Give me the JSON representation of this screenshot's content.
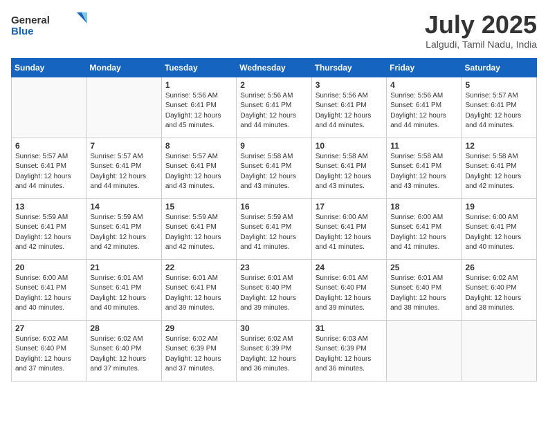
{
  "header": {
    "logo_general": "General",
    "logo_blue": "Blue",
    "title": "July 2025",
    "location": "Lalgudi, Tamil Nadu, India"
  },
  "days_of_week": [
    "Sunday",
    "Monday",
    "Tuesday",
    "Wednesday",
    "Thursday",
    "Friday",
    "Saturday"
  ],
  "weeks": [
    [
      {
        "day": "",
        "info": ""
      },
      {
        "day": "",
        "info": ""
      },
      {
        "day": "1",
        "info": "Sunrise: 5:56 AM\nSunset: 6:41 PM\nDaylight: 12 hours and 45 minutes."
      },
      {
        "day": "2",
        "info": "Sunrise: 5:56 AM\nSunset: 6:41 PM\nDaylight: 12 hours and 44 minutes."
      },
      {
        "day": "3",
        "info": "Sunrise: 5:56 AM\nSunset: 6:41 PM\nDaylight: 12 hours and 44 minutes."
      },
      {
        "day": "4",
        "info": "Sunrise: 5:56 AM\nSunset: 6:41 PM\nDaylight: 12 hours and 44 minutes."
      },
      {
        "day": "5",
        "info": "Sunrise: 5:57 AM\nSunset: 6:41 PM\nDaylight: 12 hours and 44 minutes."
      }
    ],
    [
      {
        "day": "6",
        "info": "Sunrise: 5:57 AM\nSunset: 6:41 PM\nDaylight: 12 hours and 44 minutes."
      },
      {
        "day": "7",
        "info": "Sunrise: 5:57 AM\nSunset: 6:41 PM\nDaylight: 12 hours and 44 minutes."
      },
      {
        "day": "8",
        "info": "Sunrise: 5:57 AM\nSunset: 6:41 PM\nDaylight: 12 hours and 43 minutes."
      },
      {
        "day": "9",
        "info": "Sunrise: 5:58 AM\nSunset: 6:41 PM\nDaylight: 12 hours and 43 minutes."
      },
      {
        "day": "10",
        "info": "Sunrise: 5:58 AM\nSunset: 6:41 PM\nDaylight: 12 hours and 43 minutes."
      },
      {
        "day": "11",
        "info": "Sunrise: 5:58 AM\nSunset: 6:41 PM\nDaylight: 12 hours and 43 minutes."
      },
      {
        "day": "12",
        "info": "Sunrise: 5:58 AM\nSunset: 6:41 PM\nDaylight: 12 hours and 42 minutes."
      }
    ],
    [
      {
        "day": "13",
        "info": "Sunrise: 5:59 AM\nSunset: 6:41 PM\nDaylight: 12 hours and 42 minutes."
      },
      {
        "day": "14",
        "info": "Sunrise: 5:59 AM\nSunset: 6:41 PM\nDaylight: 12 hours and 42 minutes."
      },
      {
        "day": "15",
        "info": "Sunrise: 5:59 AM\nSunset: 6:41 PM\nDaylight: 12 hours and 42 minutes."
      },
      {
        "day": "16",
        "info": "Sunrise: 5:59 AM\nSunset: 6:41 PM\nDaylight: 12 hours and 41 minutes."
      },
      {
        "day": "17",
        "info": "Sunrise: 6:00 AM\nSunset: 6:41 PM\nDaylight: 12 hours and 41 minutes."
      },
      {
        "day": "18",
        "info": "Sunrise: 6:00 AM\nSunset: 6:41 PM\nDaylight: 12 hours and 41 minutes."
      },
      {
        "day": "19",
        "info": "Sunrise: 6:00 AM\nSunset: 6:41 PM\nDaylight: 12 hours and 40 minutes."
      }
    ],
    [
      {
        "day": "20",
        "info": "Sunrise: 6:00 AM\nSunset: 6:41 PM\nDaylight: 12 hours and 40 minutes."
      },
      {
        "day": "21",
        "info": "Sunrise: 6:01 AM\nSunset: 6:41 PM\nDaylight: 12 hours and 40 minutes."
      },
      {
        "day": "22",
        "info": "Sunrise: 6:01 AM\nSunset: 6:41 PM\nDaylight: 12 hours and 39 minutes."
      },
      {
        "day": "23",
        "info": "Sunrise: 6:01 AM\nSunset: 6:40 PM\nDaylight: 12 hours and 39 minutes."
      },
      {
        "day": "24",
        "info": "Sunrise: 6:01 AM\nSunset: 6:40 PM\nDaylight: 12 hours and 39 minutes."
      },
      {
        "day": "25",
        "info": "Sunrise: 6:01 AM\nSunset: 6:40 PM\nDaylight: 12 hours and 38 minutes."
      },
      {
        "day": "26",
        "info": "Sunrise: 6:02 AM\nSunset: 6:40 PM\nDaylight: 12 hours and 38 minutes."
      }
    ],
    [
      {
        "day": "27",
        "info": "Sunrise: 6:02 AM\nSunset: 6:40 PM\nDaylight: 12 hours and 37 minutes."
      },
      {
        "day": "28",
        "info": "Sunrise: 6:02 AM\nSunset: 6:40 PM\nDaylight: 12 hours and 37 minutes."
      },
      {
        "day": "29",
        "info": "Sunrise: 6:02 AM\nSunset: 6:39 PM\nDaylight: 12 hours and 37 minutes."
      },
      {
        "day": "30",
        "info": "Sunrise: 6:02 AM\nSunset: 6:39 PM\nDaylight: 12 hours and 36 minutes."
      },
      {
        "day": "31",
        "info": "Sunrise: 6:03 AM\nSunset: 6:39 PM\nDaylight: 12 hours and 36 minutes."
      },
      {
        "day": "",
        "info": ""
      },
      {
        "day": "",
        "info": ""
      }
    ]
  ]
}
